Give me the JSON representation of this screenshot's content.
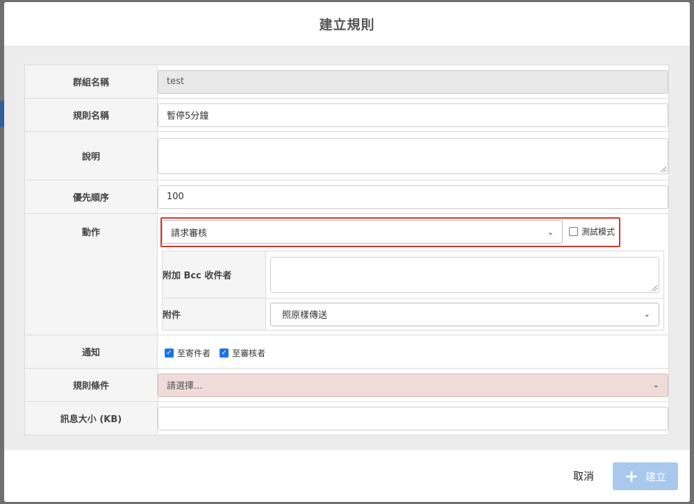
{
  "modal": {
    "title": "建立規則"
  },
  "form": {
    "group_name": {
      "label": "群組名稱",
      "value": "test"
    },
    "rule_name": {
      "label": "規則名稱",
      "value": "暫停5分鐘"
    },
    "description": {
      "label": "說明",
      "value": ""
    },
    "priority": {
      "label": "優先順序",
      "value": "100"
    },
    "action": {
      "label": "動作",
      "selected": "請求審核",
      "test_mode_label": "測試模式",
      "test_mode_checked": false,
      "bcc": {
        "label": "附加 Bcc 收件者",
        "value": ""
      },
      "attachment": {
        "label": "附件",
        "selected": "照原樣傳送"
      }
    },
    "notify": {
      "label": "通知",
      "to_sender_label": "至寄件者",
      "to_sender_checked": true,
      "to_reviewer_label": "至審核者",
      "to_reviewer_checked": true
    },
    "rule_conditions": {
      "label": "規則條件",
      "placeholder": "請選擇..."
    },
    "message_size": {
      "label": "訊息大小 (KB)",
      "value": ""
    }
  },
  "footer": {
    "cancel_label": "取消",
    "create_label": "建立"
  },
  "colors": {
    "highlight_border": "#d9342b",
    "create_button": "#a8c8ee",
    "checkbox_checked": "#1a73e8"
  },
  "icons": {
    "create": "plus-icon",
    "dropdown": "chevron-down-icon"
  }
}
